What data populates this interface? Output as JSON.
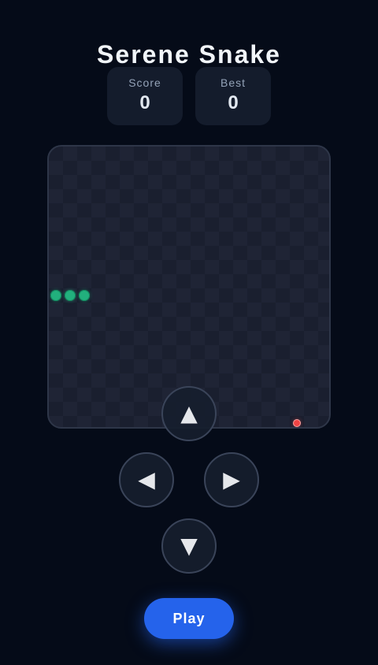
{
  "header": {
    "title": "Serene Snake"
  },
  "stats": {
    "score_label": "Score",
    "score_value": "0",
    "best_label": "Best",
    "best_value": "0"
  },
  "board": {
    "snake_color": "#22b07d",
    "food_color": "#ef4444"
  },
  "controls": {
    "up": "▲",
    "left": "◀",
    "right": "▶",
    "down": "▼"
  },
  "actions": {
    "play_label": "Play",
    "play_color": "#2563eb"
  }
}
